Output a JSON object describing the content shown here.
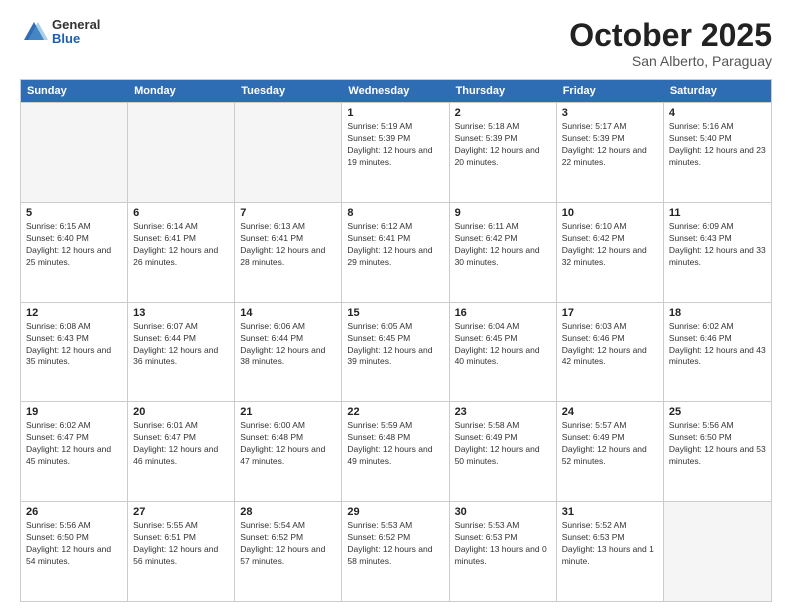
{
  "logo": {
    "general": "General",
    "blue": "Blue"
  },
  "title": "October 2025",
  "location": "San Alberto, Paraguay",
  "weekdays": [
    "Sunday",
    "Monday",
    "Tuesday",
    "Wednesday",
    "Thursday",
    "Friday",
    "Saturday"
  ],
  "rows": [
    [
      {
        "day": "",
        "empty": true
      },
      {
        "day": "",
        "empty": true
      },
      {
        "day": "",
        "empty": true
      },
      {
        "day": "1",
        "sunrise": "5:19 AM",
        "sunset": "5:39 PM",
        "daylight": "12 hours and 19 minutes."
      },
      {
        "day": "2",
        "sunrise": "5:18 AM",
        "sunset": "5:39 PM",
        "daylight": "12 hours and 20 minutes."
      },
      {
        "day": "3",
        "sunrise": "5:17 AM",
        "sunset": "5:39 PM",
        "daylight": "12 hours and 22 minutes."
      },
      {
        "day": "4",
        "sunrise": "5:16 AM",
        "sunset": "5:40 PM",
        "daylight": "12 hours and 23 minutes."
      }
    ],
    [
      {
        "day": "5",
        "sunrise": "6:15 AM",
        "sunset": "6:40 PM",
        "daylight": "12 hours and 25 minutes."
      },
      {
        "day": "6",
        "sunrise": "6:14 AM",
        "sunset": "6:41 PM",
        "daylight": "12 hours and 26 minutes."
      },
      {
        "day": "7",
        "sunrise": "6:13 AM",
        "sunset": "6:41 PM",
        "daylight": "12 hours and 28 minutes."
      },
      {
        "day": "8",
        "sunrise": "6:12 AM",
        "sunset": "6:41 PM",
        "daylight": "12 hours and 29 minutes."
      },
      {
        "day": "9",
        "sunrise": "6:11 AM",
        "sunset": "6:42 PM",
        "daylight": "12 hours and 30 minutes."
      },
      {
        "day": "10",
        "sunrise": "6:10 AM",
        "sunset": "6:42 PM",
        "daylight": "12 hours and 32 minutes."
      },
      {
        "day": "11",
        "sunrise": "6:09 AM",
        "sunset": "6:43 PM",
        "daylight": "12 hours and 33 minutes."
      }
    ],
    [
      {
        "day": "12",
        "sunrise": "6:08 AM",
        "sunset": "6:43 PM",
        "daylight": "12 hours and 35 minutes."
      },
      {
        "day": "13",
        "sunrise": "6:07 AM",
        "sunset": "6:44 PM",
        "daylight": "12 hours and 36 minutes."
      },
      {
        "day": "14",
        "sunrise": "6:06 AM",
        "sunset": "6:44 PM",
        "daylight": "12 hours and 38 minutes."
      },
      {
        "day": "15",
        "sunrise": "6:05 AM",
        "sunset": "6:45 PM",
        "daylight": "12 hours and 39 minutes."
      },
      {
        "day": "16",
        "sunrise": "6:04 AM",
        "sunset": "6:45 PM",
        "daylight": "12 hours and 40 minutes."
      },
      {
        "day": "17",
        "sunrise": "6:03 AM",
        "sunset": "6:46 PM",
        "daylight": "12 hours and 42 minutes."
      },
      {
        "day": "18",
        "sunrise": "6:02 AM",
        "sunset": "6:46 PM",
        "daylight": "12 hours and 43 minutes."
      }
    ],
    [
      {
        "day": "19",
        "sunrise": "6:02 AM",
        "sunset": "6:47 PM",
        "daylight": "12 hours and 45 minutes."
      },
      {
        "day": "20",
        "sunrise": "6:01 AM",
        "sunset": "6:47 PM",
        "daylight": "12 hours and 46 minutes."
      },
      {
        "day": "21",
        "sunrise": "6:00 AM",
        "sunset": "6:48 PM",
        "daylight": "12 hours and 47 minutes."
      },
      {
        "day": "22",
        "sunrise": "5:59 AM",
        "sunset": "6:48 PM",
        "daylight": "12 hours and 49 minutes."
      },
      {
        "day": "23",
        "sunrise": "5:58 AM",
        "sunset": "6:49 PM",
        "daylight": "12 hours and 50 minutes."
      },
      {
        "day": "24",
        "sunrise": "5:57 AM",
        "sunset": "6:49 PM",
        "daylight": "12 hours and 52 minutes."
      },
      {
        "day": "25",
        "sunrise": "5:56 AM",
        "sunset": "6:50 PM",
        "daylight": "12 hours and 53 minutes."
      }
    ],
    [
      {
        "day": "26",
        "sunrise": "5:56 AM",
        "sunset": "6:50 PM",
        "daylight": "12 hours and 54 minutes."
      },
      {
        "day": "27",
        "sunrise": "5:55 AM",
        "sunset": "6:51 PM",
        "daylight": "12 hours and 56 minutes."
      },
      {
        "day": "28",
        "sunrise": "5:54 AM",
        "sunset": "6:52 PM",
        "daylight": "12 hours and 57 minutes."
      },
      {
        "day": "29",
        "sunrise": "5:53 AM",
        "sunset": "6:52 PM",
        "daylight": "12 hours and 58 minutes."
      },
      {
        "day": "30",
        "sunrise": "5:53 AM",
        "sunset": "6:53 PM",
        "daylight": "13 hours and 0 minutes."
      },
      {
        "day": "31",
        "sunrise": "5:52 AM",
        "sunset": "6:53 PM",
        "daylight": "13 hours and 1 minute."
      },
      {
        "day": "",
        "empty": true
      }
    ]
  ]
}
